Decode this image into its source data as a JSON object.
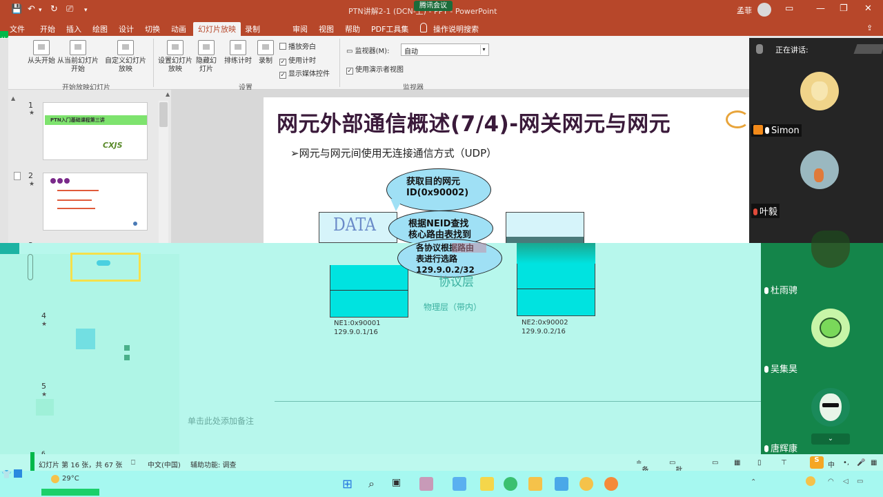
{
  "titlebar": {
    "doc_title": "PTN讲解2-1 (DCN-上) - PPT - PowerPoint",
    "meeting": "腾讯会议",
    "user": "孟菲",
    "icons": [
      "save-icon",
      "undo-icon",
      "redo-icon",
      "customize-icon",
      "minimize-icon",
      "restore-icon",
      "close-icon"
    ]
  },
  "menubar": {
    "share": "共享",
    "tabs": [
      "文件",
      "开始",
      "插入",
      "绘图",
      "设计",
      "切换",
      "动画",
      "幻灯片放映",
      "录制",
      "审阅",
      "视图",
      "帮助",
      "PDF工具集"
    ],
    "active_tab": "幻灯片放映",
    "tell_me": "操作说明搜索"
  },
  "ribbon": {
    "start_group": {
      "from_start": "从头开始",
      "from_current": "从当前幻灯片开始",
      "custom": "自定义幻灯片放映",
      "label": "开始放映幻灯片"
    },
    "setup_group": {
      "setup": "设置幻灯片放映",
      "hide": "隐藏幻灯片",
      "rehearse": "排练计时",
      "record": "录制",
      "play_narration": "播放旁白",
      "use_timings": "使用计时",
      "show_media": "显示媒体控件",
      "label": "设置"
    },
    "monitor_group": {
      "monitor_label": "监视器(M):",
      "monitor_value": "自动",
      "presenter_view": "使用演示者视图",
      "label": "监视器"
    }
  },
  "thumbnails": [
    {
      "num": "1",
      "title": "PTN入门基础课程第三讲",
      "logo": "CXJS"
    },
    {
      "num": "2"
    },
    {
      "num": "3"
    },
    {
      "num": "4"
    },
    {
      "num": "5"
    },
    {
      "num": "6"
    }
  ],
  "slide": {
    "title": "网元外部通信概述(7/4)-网关网元与网元",
    "bullet": "➢网元与网元间使用无连接通信方式（UDP）",
    "data_label": "DATA",
    "callouts": {
      "c1": "获取目的网元\nID(0x90002)",
      "c2": "根据NEID查找\n核心路由表找到",
      "c3": "各协议根据路由\n表进行选路\n129.9.0.2/32"
    },
    "protocol_layer": "协议层",
    "physical_layer": "物理层（带内）",
    "ne1": "NE1:0x90001\n129.9.0.1/16",
    "ne2": "NE2:0x90002\n129.9.0.2/16",
    "notes_placeholder": "单击此处添加备注"
  },
  "meeting_panel": {
    "speaking_label": "正在讲话:",
    "participants": [
      "Simon",
      "叶毅",
      "杜雨骋",
      "吴集昊",
      "唐辉康"
    ]
  },
  "statusbar": {
    "slide_info": "幻灯片 第 16 张，共 67 张",
    "language": "中文(中国)",
    "accessibility": "辅助功能: 调查",
    "notes": "备注",
    "comments": "批注"
  },
  "taskbar": {
    "weather": "29°C",
    "ime": "中"
  }
}
